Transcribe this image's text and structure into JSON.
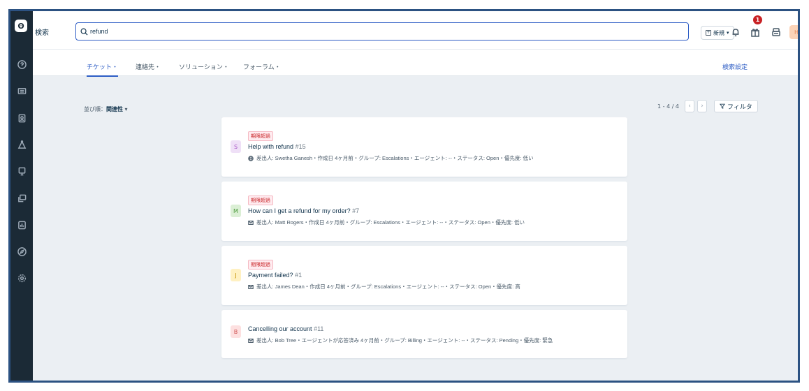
{
  "sidebar": {
    "logo": "ʘ",
    "items": [
      "question-circle-icon",
      "ticket-icon",
      "contacts-icon",
      "social-icon",
      "solutions-icon",
      "forums-icon",
      "reports-icon",
      "discover-icon",
      "settings-icon"
    ]
  },
  "header": {
    "title": "検索",
    "search_value": "refund",
    "new_label": "新規",
    "notification_count": "1",
    "avatar_initial": "H"
  },
  "tabs": [
    {
      "label": "チケット・",
      "active": true
    },
    {
      "label": "連絡先・",
      "active": false
    },
    {
      "label": "ソリューション・",
      "active": false
    },
    {
      "label": "フォーラム・",
      "active": false
    }
  ],
  "search_settings_label": "検索設定",
  "sort": {
    "prefix": "並び順：",
    "value": "関連性"
  },
  "pager": {
    "text": "1 - 4 / 4",
    "prev": "‹",
    "next": "›"
  },
  "filter_label": "フィルタ",
  "tickets": [
    {
      "status_tag": "期限超過",
      "avatar": "S",
      "avatar_bg": "#efe0f7",
      "avatar_fg": "#a855c7",
      "subject": "Help with refund",
      "number": "#15",
      "meta": "差出人: Swetha Ganesh・作成日 4ヶ月前・グループ: Escalations・エージェント: --・ステータス: Open・優先度: 低い",
      "source_icon": "globe-icon"
    },
    {
      "status_tag": "期限超過",
      "avatar": "M",
      "avatar_bg": "#dbefd5",
      "avatar_fg": "#4c9a3d",
      "subject": "How can I get a refund for my order?",
      "number": "#7",
      "meta": "差出人: Matt Rogers・作成日 4ヶ月前・グループ: Escalations・エージェント: --・ステータス: Open・優先度: 低い",
      "source_icon": "email-icon"
    },
    {
      "status_tag": "期限超過",
      "avatar": "J",
      "avatar_bg": "#fff1c2",
      "avatar_fg": "#c49000",
      "subject": "Payment failed?",
      "number": "#1",
      "meta": "差出人: James Dean・作成日 4ヶ月前・グループ: Escalations・エージェント: --・ステータス: Open・優先度: 高",
      "source_icon": "email-icon"
    },
    {
      "status_tag": "",
      "avatar": "B",
      "avatar_bg": "#fde0e0",
      "avatar_fg": "#d05555",
      "subject": "Cancelling our account",
      "number": "#11",
      "meta": "差出人: Bob Tree・エージェントが応答済み 4ヶ月前・グループ: Billing・エージェント: --・ステータス: Pending・優先度: 緊急",
      "source_icon": "email-icon"
    }
  ]
}
